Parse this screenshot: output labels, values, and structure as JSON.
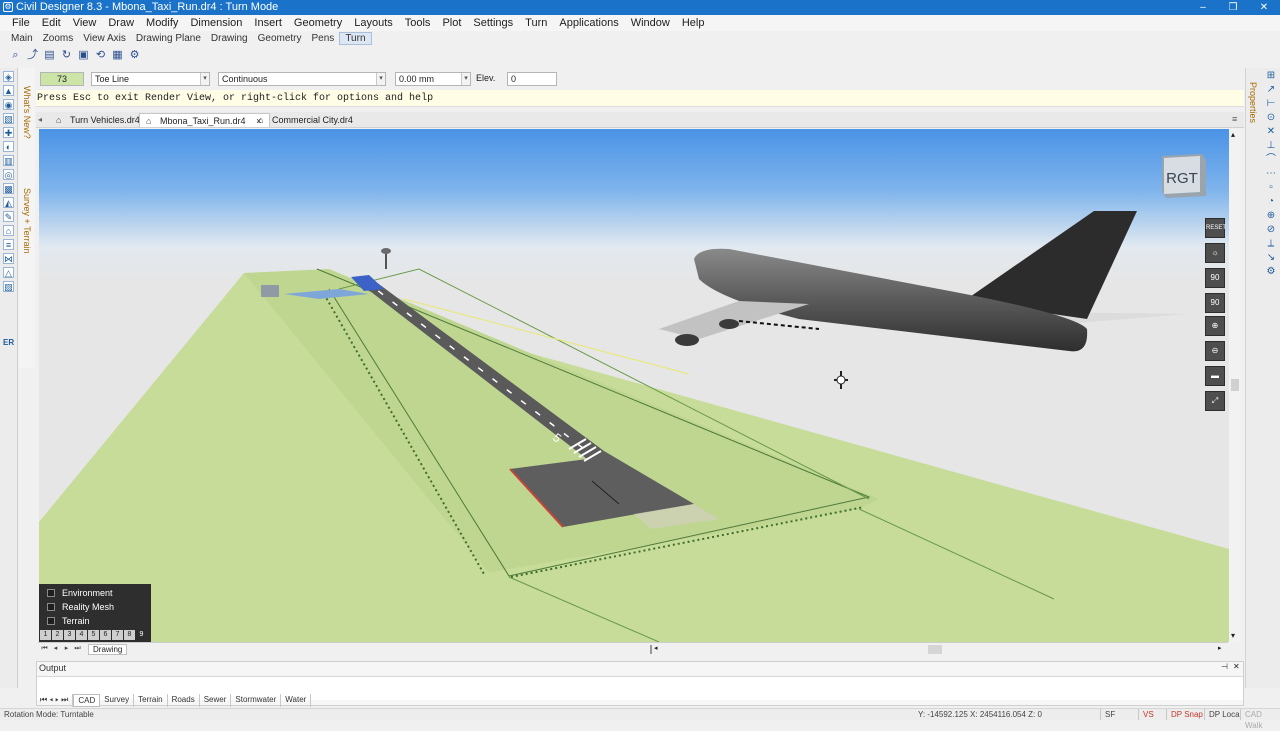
{
  "window": {
    "title": "Civil Designer 8.3 - Mbona_Taxi_Run.dr4 : Turn Mode",
    "minimize": "–",
    "restore": "❐",
    "close": "✕"
  },
  "menu": [
    "File",
    "Edit",
    "View",
    "Draw",
    "Modify",
    "Dimension",
    "Insert",
    "Geometry",
    "Layouts",
    "Tools",
    "Plot",
    "Settings",
    "Turn",
    "Applications",
    "Window",
    "Help"
  ],
  "toolbar_tabs": [
    "Main",
    "Zooms",
    "View Axis",
    "Drawing Plane",
    "Drawing",
    "Geometry",
    "Pens",
    "Turn"
  ],
  "left_strip_labels": {
    "whats_new": "What's New?",
    "survey_terrain": "Survey + Terrain"
  },
  "left_strip_er": "ER",
  "right_strip_label": "Properties",
  "properties": {
    "color_value": "73",
    "linetype": "Toe Line",
    "style": "Continuous",
    "width": "0.00 mm",
    "elev_label": "Elev.",
    "elev_value": "0"
  },
  "command_line": "Press Esc to exit Render View, or right-click for options and help",
  "doc_tabs": [
    {
      "label": "Turn Vehicles.dr4",
      "active": false
    },
    {
      "label": "Mbona_Taxi_Run.dr4",
      "active": true
    },
    {
      "label": "Commercial City.dr4",
      "active": false
    }
  ],
  "doc_tab_close": "×",
  "nav_cube_label": "RGT",
  "view_controls": {
    "reset": "RESET",
    "rot1": "90",
    "rot2": "90"
  },
  "layers": [
    {
      "label": "Environment",
      "checked": false
    },
    {
      "label": "Reality Mesh",
      "checked": false
    },
    {
      "label": "Terrain",
      "checked": false
    }
  ],
  "layer_buttons": [
    "1",
    "2",
    "3",
    "4",
    "5",
    "6",
    "7",
    "8",
    "9"
  ],
  "sheet_tab": "Drawing",
  "output_panel": {
    "title": "Output",
    "pin": "⊣",
    "close": "✕"
  },
  "bottom_tabs": [
    {
      "label": "CAD",
      "active": true
    },
    {
      "label": "Survey",
      "active": false
    },
    {
      "label": "Terrain",
      "active": false
    },
    {
      "label": "Roads",
      "active": false
    },
    {
      "label": "Sewer",
      "active": false
    },
    {
      "label": "Stormwater",
      "active": false
    },
    {
      "label": "Water",
      "active": false
    }
  ],
  "status": {
    "left": "Rotation Mode: Turntable",
    "coords": "Y: -14592.125 X: 2454116.054 Z: 0",
    "buttons": [
      "SF",
      "VS",
      "DP Snap",
      "DP Local",
      "CAD Walk"
    ]
  },
  "runway_marking": "5"
}
